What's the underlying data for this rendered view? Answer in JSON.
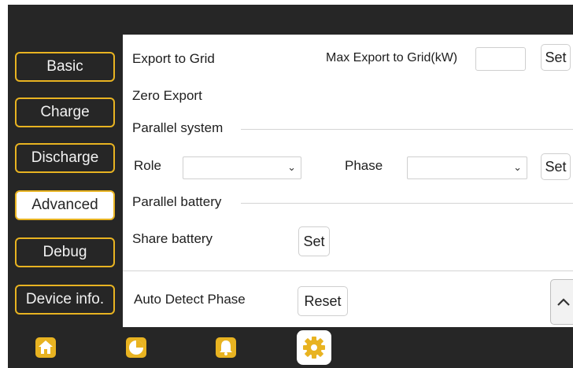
{
  "sidebar": {
    "items": [
      {
        "label": "Basic",
        "active": false
      },
      {
        "label": "Charge",
        "active": false
      },
      {
        "label": "Discharge",
        "active": false
      },
      {
        "label": "Advanced",
        "active": true
      },
      {
        "label": "Debug",
        "active": false
      },
      {
        "label": "Device info.",
        "active": false
      }
    ]
  },
  "export": {
    "label": "Export to Grid",
    "max_label": "Max Export to Grid(kW)",
    "max_value": "",
    "set_label": "Set",
    "zero_export_label": "Zero Export"
  },
  "parallel_system": {
    "heading": "Parallel system",
    "role_label": "Role",
    "role_value": "",
    "phase_label": "Phase",
    "phase_value": "",
    "set_label": "Set"
  },
  "parallel_battery": {
    "heading": "Parallel battery",
    "share_label": "Share battery",
    "set_label": "Set"
  },
  "auto_detect": {
    "label": "Auto Detect Phase",
    "reset_label": "Reset"
  },
  "scroll_up_icon": "chevron-up-icon",
  "bottom_nav": {
    "icons": [
      "home-icon",
      "pie-chart-icon",
      "bell-icon",
      "gear-icon"
    ],
    "active": "gear-icon"
  },
  "colors": {
    "accent": "#e8b321",
    "background": "#262626",
    "panel": "#ffffff"
  }
}
